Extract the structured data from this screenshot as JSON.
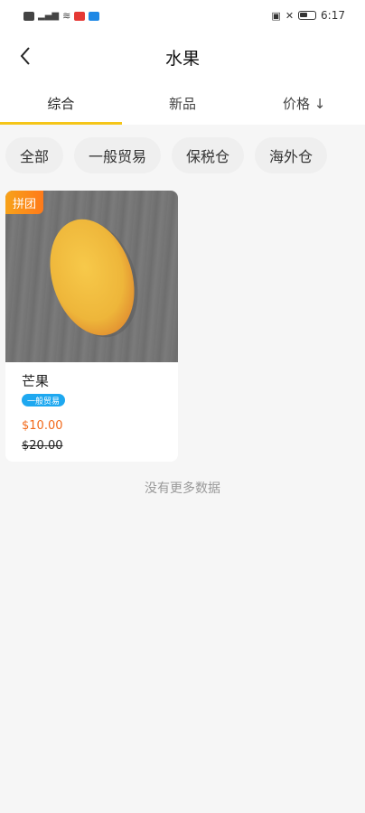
{
  "status_bar": {
    "time": "6:17"
  },
  "header": {
    "title": "水果"
  },
  "tabs": [
    {
      "label": "综合",
      "active": true
    },
    {
      "label": "新品",
      "active": false
    },
    {
      "label": "价格 ↓",
      "active": false
    }
  ],
  "filters": [
    {
      "label": "全部"
    },
    {
      "label": "一般贸易"
    },
    {
      "label": "保税仓"
    },
    {
      "label": "海外仓"
    }
  ],
  "products": [
    {
      "badge": "拼团",
      "name": "芒果",
      "tag": "一般贸易",
      "price": "$10.00",
      "original_price": "$20.00"
    }
  ],
  "footer_note": "没有更多数据",
  "colors": {
    "accent": "#f5c518",
    "badge": "#ff7a1a",
    "tag": "#1ea8f0",
    "price": "#f26a1b"
  }
}
